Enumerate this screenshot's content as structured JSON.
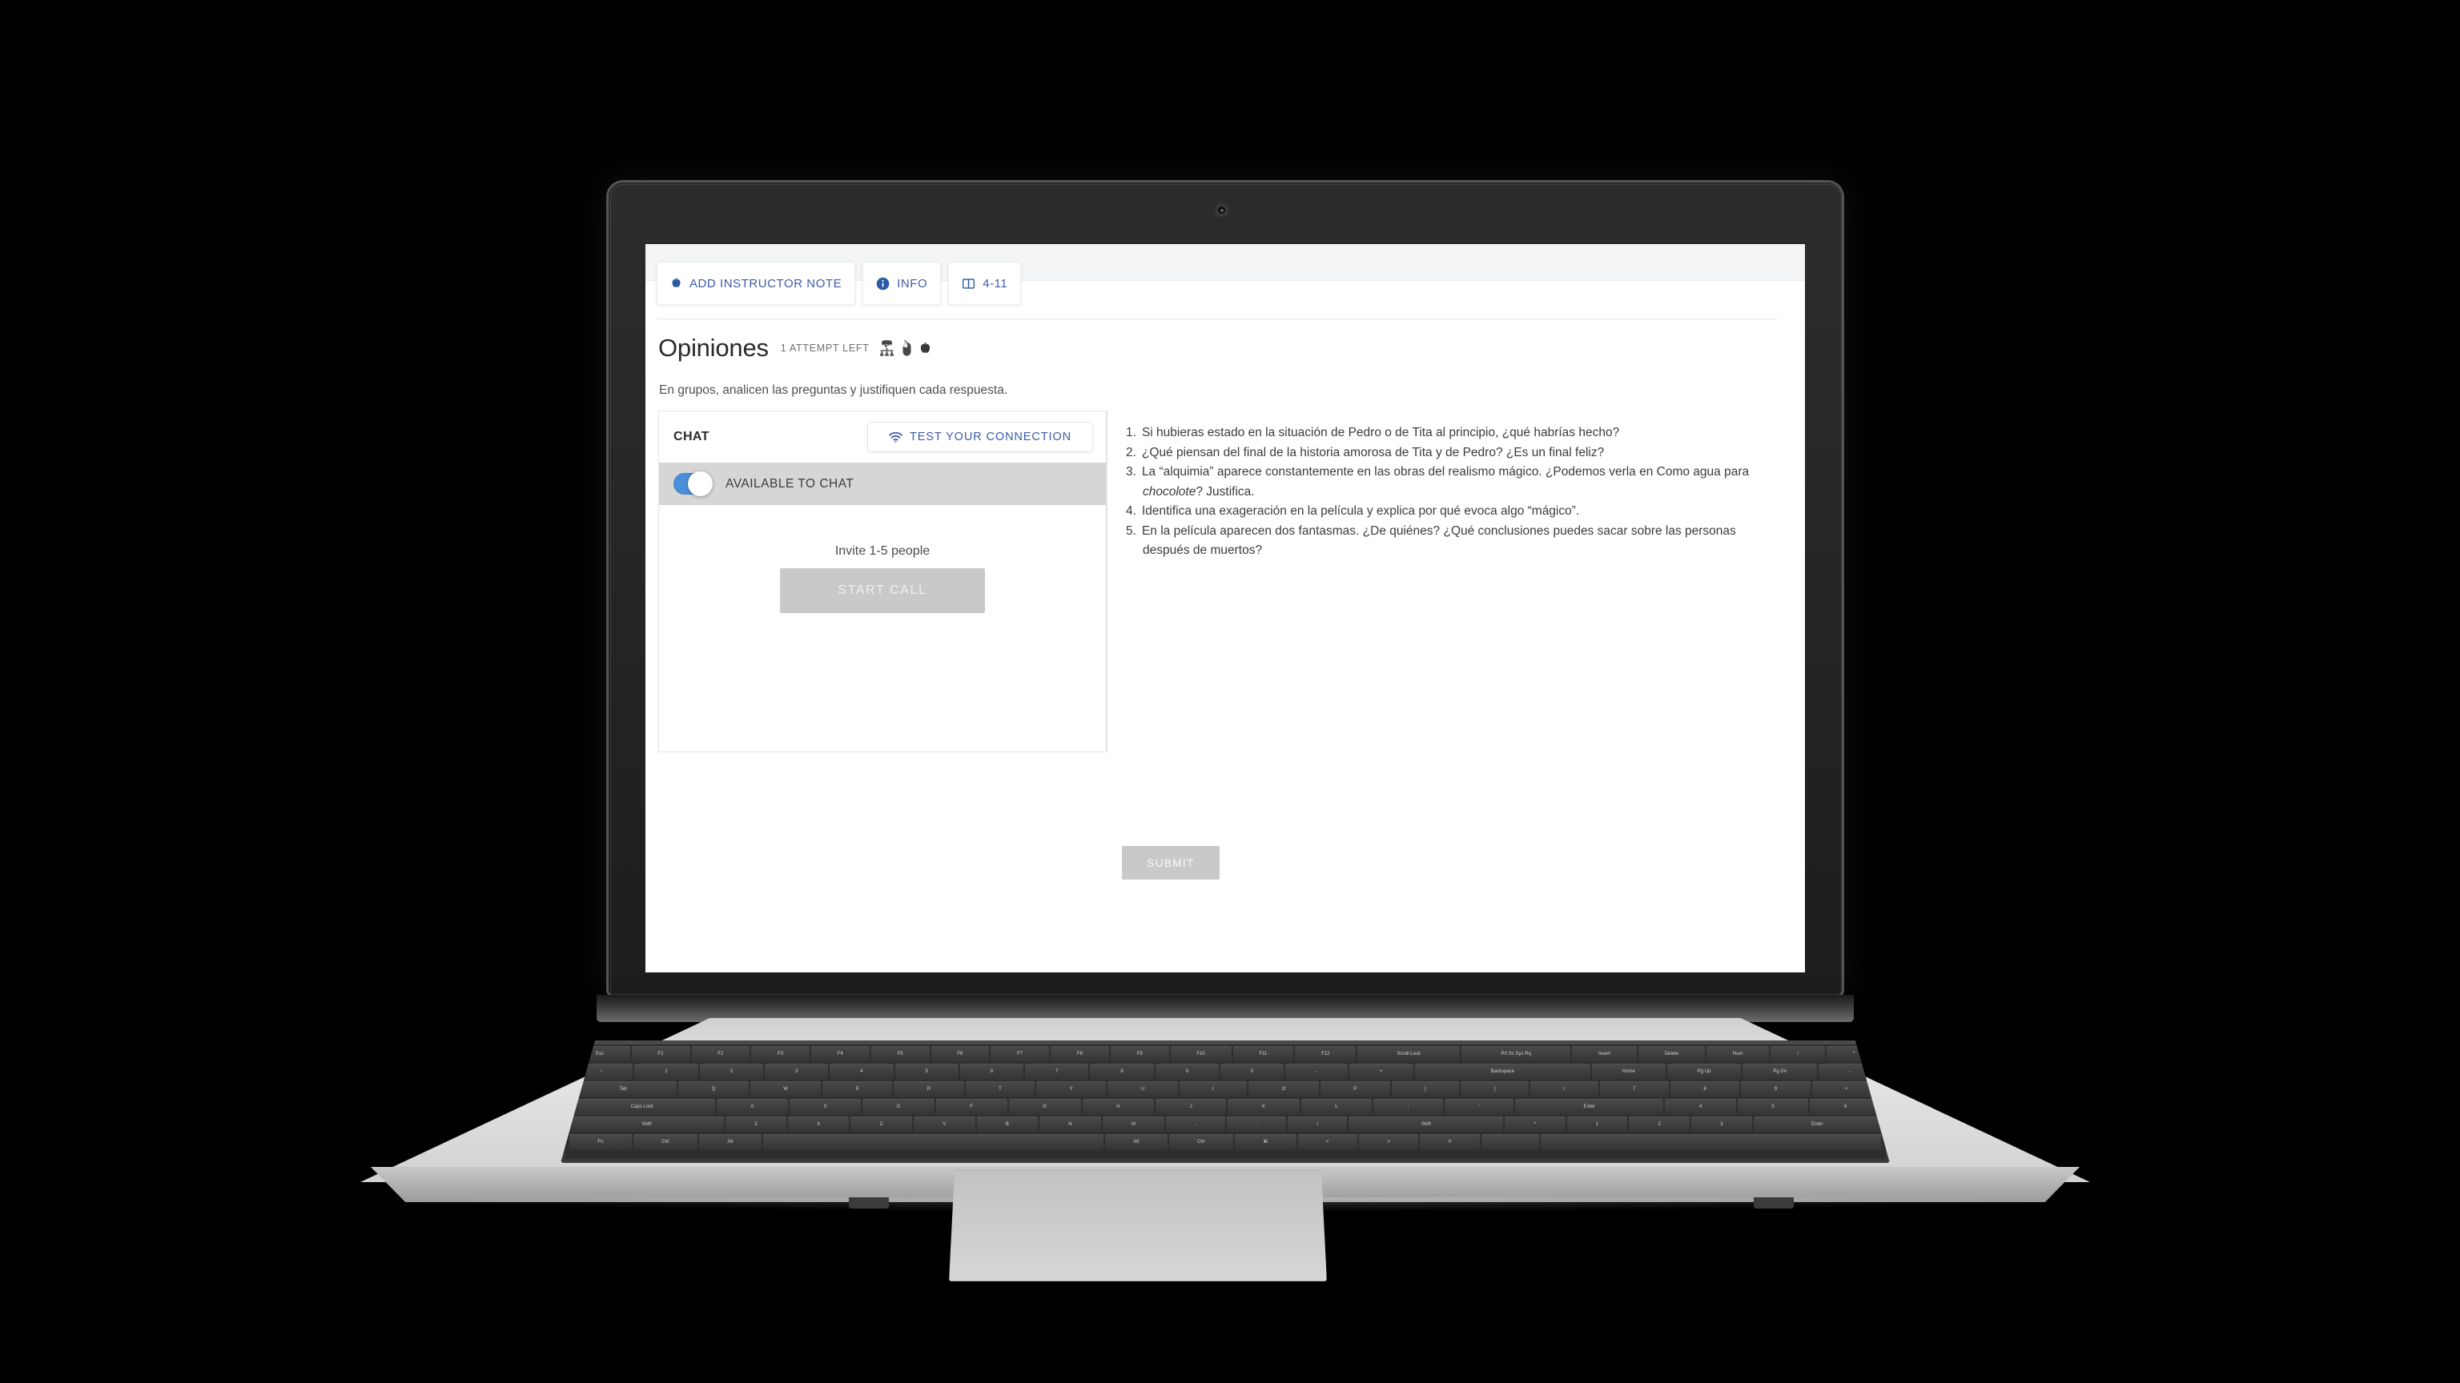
{
  "toolbar": {
    "buttons": [
      {
        "label": "ADD INSTRUCTOR NOTE",
        "icon": "apple-icon"
      },
      {
        "label": "INFO",
        "icon": "info-circle-icon"
      },
      {
        "label": "4-11",
        "icon": "open-book-icon"
      }
    ]
  },
  "activity": {
    "title": "Opiniones",
    "attempts_label": "1 ATTEMPT LEFT",
    "badge_icons": [
      "group-discussion-icon",
      "mouse-icon",
      "apple-icon"
    ],
    "instructions": "En grupos, analicen las preguntas y justifiquen cada respuesta."
  },
  "chat": {
    "heading": "CHAT",
    "test_connection_label": "TEST YOUR CONNECTION",
    "test_connection_icon": "wifi-icon",
    "available_label": "AVAILABLE TO CHAT",
    "toggle_state": "on",
    "invite_text": "Invite 1-5 people",
    "start_call_label": "START CALL"
  },
  "questions": [
    {
      "number": "1.",
      "text": "Si hubieras estado en la situación de Pedro o de Tita al principio, ¿qué habrías hecho?"
    },
    {
      "number": "2.",
      "text": "¿Qué piensan del final de la historia amorosa de Tita y de Pedro? ¿Es un final feliz?"
    },
    {
      "number": "3.",
      "text": "La “alquimia” aparece constantemente en las obras del realismo mágico. ¿Podemos verla en Como agua para"
    },
    {
      "number": "4.",
      "text": "Identifica una exageración en la película y explica por qué evoca algo “mágico”."
    },
    {
      "number": "5.",
      "text": "En la película aparecen dos fantasmas. ¿De quiénes? ¿Qué conclusiones puedes sacar sobre las personas"
    }
  ],
  "question3_continuation_italic": "chocolote",
  "question3_continuation_rest": "? Justifica.",
  "question5_continuation": "después de muertos?",
  "submit": {
    "label": "SUBMIT"
  },
  "colors": {
    "accent_blue": "#3b5ba8",
    "toggle_blue": "#4a90d9",
    "disabled_gray": "#c9c9c9",
    "available_bar": "#d6d6d6"
  },
  "keyboard": {
    "row_fn": [
      "Esc",
      "F1",
      "F2",
      "F3",
      "F4",
      "F5",
      "F6",
      "F7",
      "F8",
      "F9",
      "F10",
      "F11",
      "F12",
      "Scroll Lock",
      "Prt Sc Sys Rq",
      "Insert",
      "Delete",
      "Num",
      "/",
      "*"
    ],
    "row_num": [
      "~",
      "1",
      "2",
      "3",
      "4",
      "5",
      "6",
      "7",
      "8",
      "9",
      "0",
      "-",
      "+",
      "Backspace",
      "Home",
      "Pg Up",
      "Pg Dn",
      "-"
    ],
    "row_q": [
      "Tab",
      "Q",
      "W",
      "E",
      "R",
      "T",
      "Y",
      "U",
      "I",
      "O",
      "P",
      "[",
      "]",
      "\\",
      "7",
      "8",
      "9",
      "+"
    ],
    "row_a": [
      "Caps Lock",
      "A",
      "S",
      "D",
      "F",
      "G",
      "H",
      "J",
      "K",
      "L",
      ";",
      "'",
      "Enter",
      "4",
      "5",
      "6"
    ],
    "row_z": [
      "Shift",
      "Z",
      "X",
      "C",
      "V",
      "B",
      "N",
      "M",
      ",",
      ".",
      "/",
      "Shift",
      "^",
      "1",
      "2",
      "3",
      "Enter"
    ],
    "row_sp": [
      "Fn",
      "Ctrl",
      "Alt",
      "",
      "Alt",
      "Ctrl",
      "⌘",
      "<",
      ">",
      "0",
      ".",
      ""
    ]
  }
}
